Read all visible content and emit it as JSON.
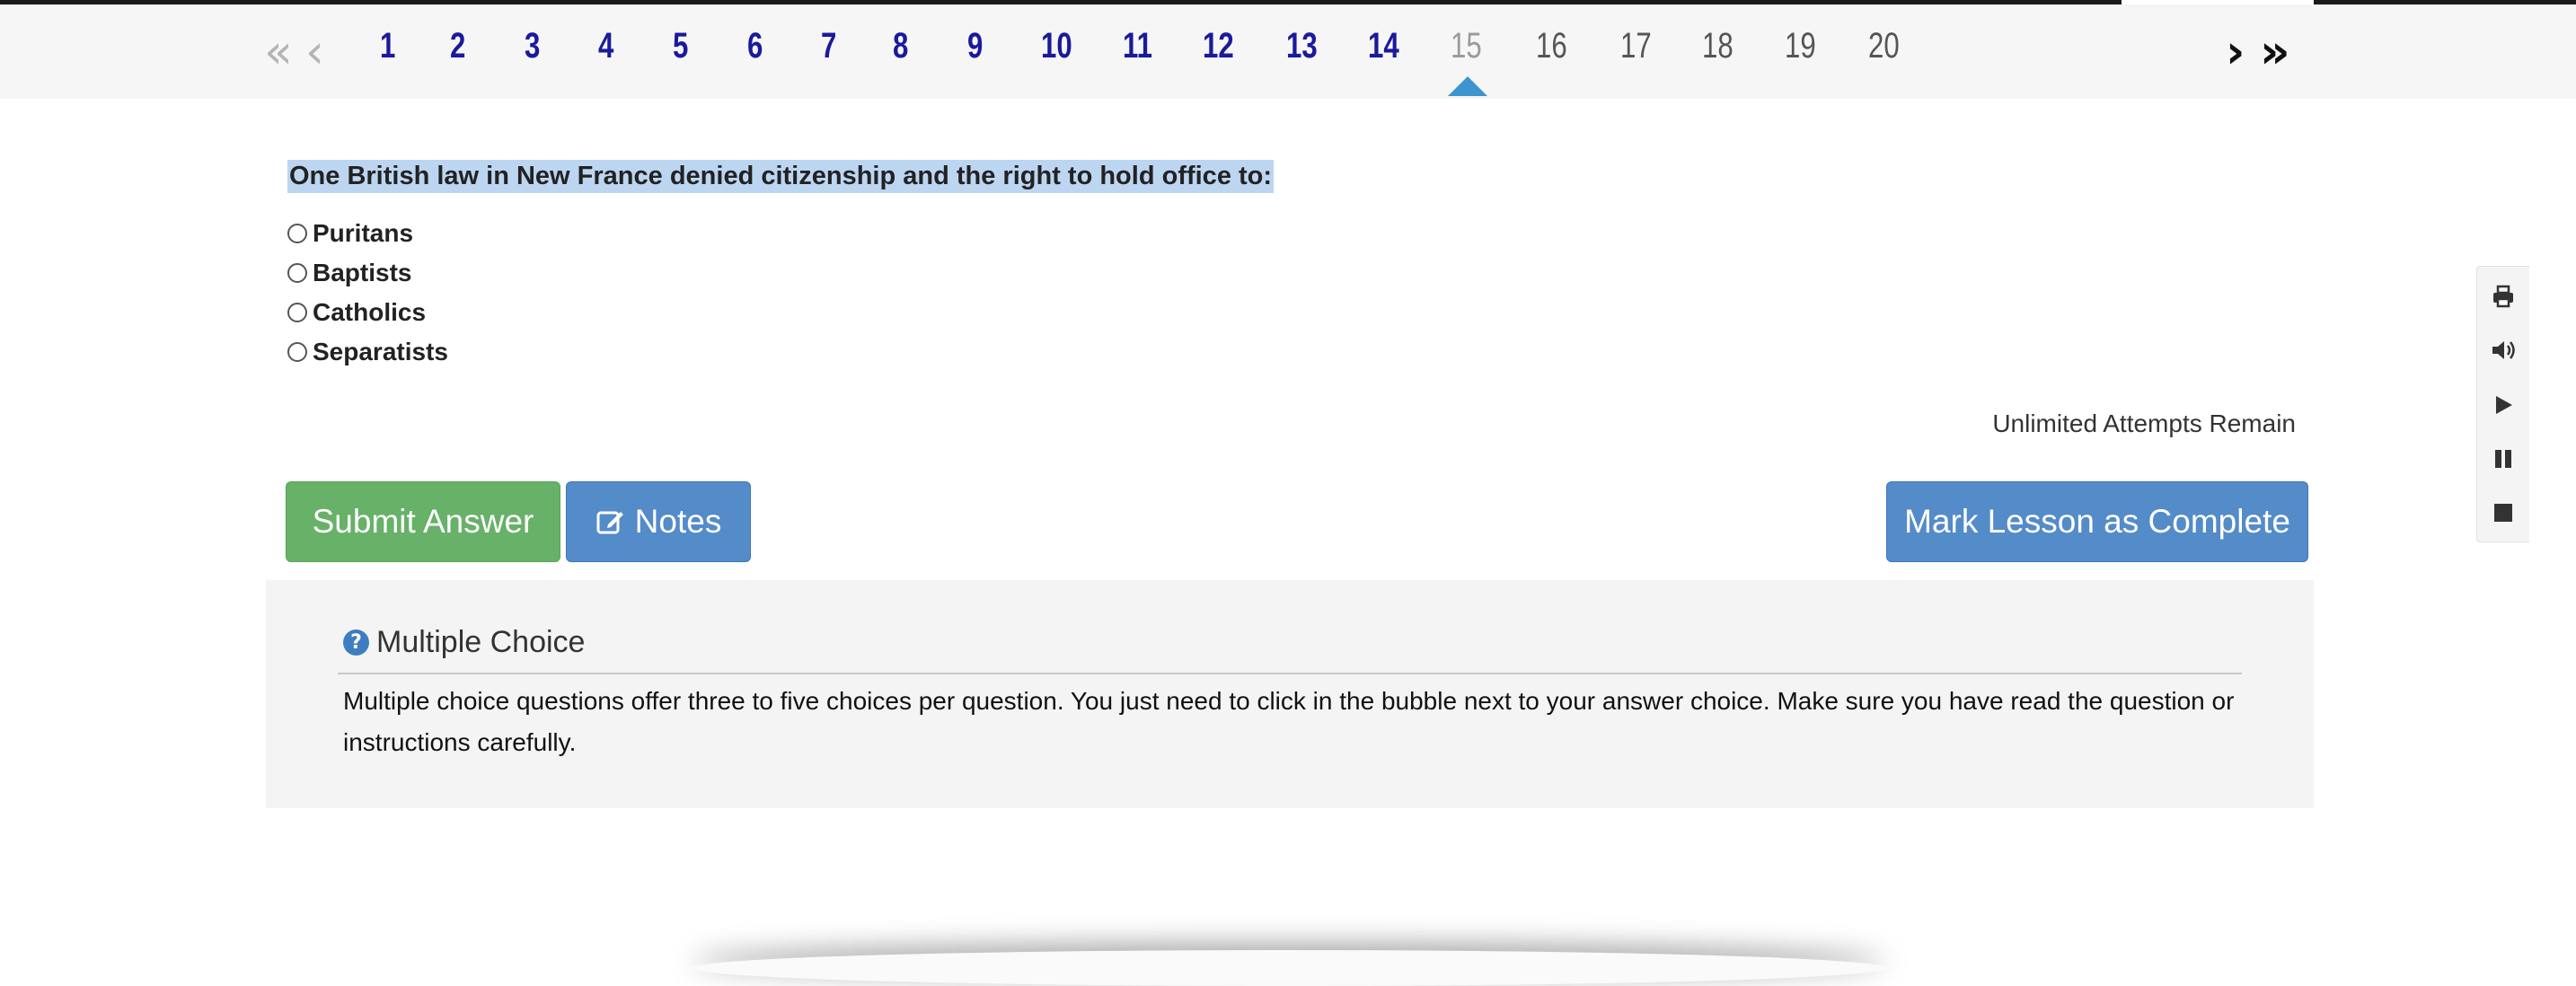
{
  "nav": {
    "first_glyph": "«",
    "prev_glyph": "‹",
    "next_glyph": "›",
    "last_glyph": "»",
    "pages": [
      "1",
      "2",
      "3",
      "4",
      "5",
      "6",
      "7",
      "8",
      "9",
      "10",
      "11",
      "12",
      "13",
      "14",
      "15",
      "16",
      "17",
      "18",
      "19",
      "20"
    ],
    "current_page": "15"
  },
  "question": {
    "text": "One British law in New France denied citizenship and the right to hold office to:",
    "choices": [
      "Puritans",
      "Baptists",
      "Catholics",
      "Separatists"
    ]
  },
  "attempts_text": "Unlimited Attempts Remain",
  "buttons": {
    "submit": "Submit Answer",
    "notes": "Notes",
    "complete": "Mark Lesson as Complete"
  },
  "info": {
    "title": "Multiple Choice",
    "body": "Multiple choice questions offer three to five choices per question. You just need to click in the bubble next to your answer choice. Make sure you have read the question or instructions carefully."
  },
  "toolbar_icons": [
    "print-icon",
    "speaker-icon",
    "play-icon",
    "pause-icon",
    "stop-icon"
  ],
  "colors": {
    "submit_green": "#67b168",
    "primary_blue": "#548bc9",
    "visited_page": "#1a1a9c",
    "current_marker": "#3d95cf",
    "question_highlight": "#bcd6f2"
  }
}
